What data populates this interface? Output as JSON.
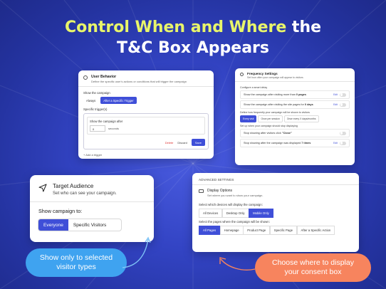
{
  "headline": {
    "part1": "Control When and Where",
    "part2": " the",
    "line2": "T&C Box Appears"
  },
  "colors": {
    "background": "#2d3ea8",
    "accent_yellow": "#e8f56a",
    "primary_button": "#3f4fd8",
    "pill_blue": "#3fa3f0",
    "pill_orange": "#f7845e"
  },
  "user_behavior": {
    "icon": "user-icon",
    "title": "User Behavior",
    "subtitle": "Define the specific user's actions or conditions that will trigger the campaign",
    "show_label": "Show the campaign",
    "options": [
      "Always",
      "After a Specific Trigger"
    ],
    "selected": "After a Specific Trigger",
    "triggers_label": "Specific trigger(s)",
    "trigger_title": "Show the campaign after",
    "trigger_value": "0",
    "trigger_unit": "seconds",
    "delete_label": "Delete",
    "discard_label": "Discard",
    "save_label": "Save",
    "add_trigger_label": "+ Add a trigger"
  },
  "frequency": {
    "icon": "clock-icon",
    "title": "Frequency Settings",
    "subtitle": "Set how often your campaign will appear to visitors",
    "delay_label": "Configure a smart delay",
    "delay_items": [
      {
        "pre": "Show the campaign after visiting more than ",
        "bold": "0 pages",
        "edit": "Edit"
      },
      {
        "pre": "Show the campaign after visiting the site pages for ",
        "bold": "0 days",
        "edit": "Edit"
      }
    ],
    "freq_label": "Define how frequently your campaign will be shown to visitors",
    "freq_options": [
      "Every visit",
      "Once per session",
      "Once every X days/months"
    ],
    "freq_selected": "Every visit",
    "stop_label": "Set up when your campaign should stop displaying",
    "stop_items": [
      {
        "pre": "Stop showing after visitors click ",
        "bold": "\"Close\"",
        "edit": ""
      },
      {
        "pre": "Stop showing after the campaign was displayed ",
        "bold": "7 times",
        "edit": "Edit"
      }
    ]
  },
  "target_audience": {
    "icon": "navigation-arrow-icon",
    "title": "Target Audience",
    "subtitle": "Set who can see your campaign.",
    "show_label": "Show campaign to:",
    "options": [
      "Everyone",
      "Specific Visitors"
    ],
    "selected": "Everyone"
  },
  "display_options": {
    "section": "ADVANCED SETTINGS",
    "icon": "monitor-icon",
    "title": "Display Options",
    "subtitle": "Set where you want to show your campaign.",
    "devices_label": "Select which devices will display the campaign:",
    "devices": [
      "All Devices",
      "Desktop Only",
      "Mobile Only"
    ],
    "devices_selected": "Mobile Only",
    "pages_label": "Select the pages where the campaign will be shown:",
    "pages": [
      "All Pages",
      "Homepage",
      "Product Page",
      "Specific Page",
      "After a Specific Action"
    ],
    "pages_selected": "All Pages"
  },
  "callouts": {
    "left_line1": "Show only to selected",
    "left_line2": "visitor types",
    "right_line1": "Choose where to display",
    "right_line2": "your consent box"
  }
}
